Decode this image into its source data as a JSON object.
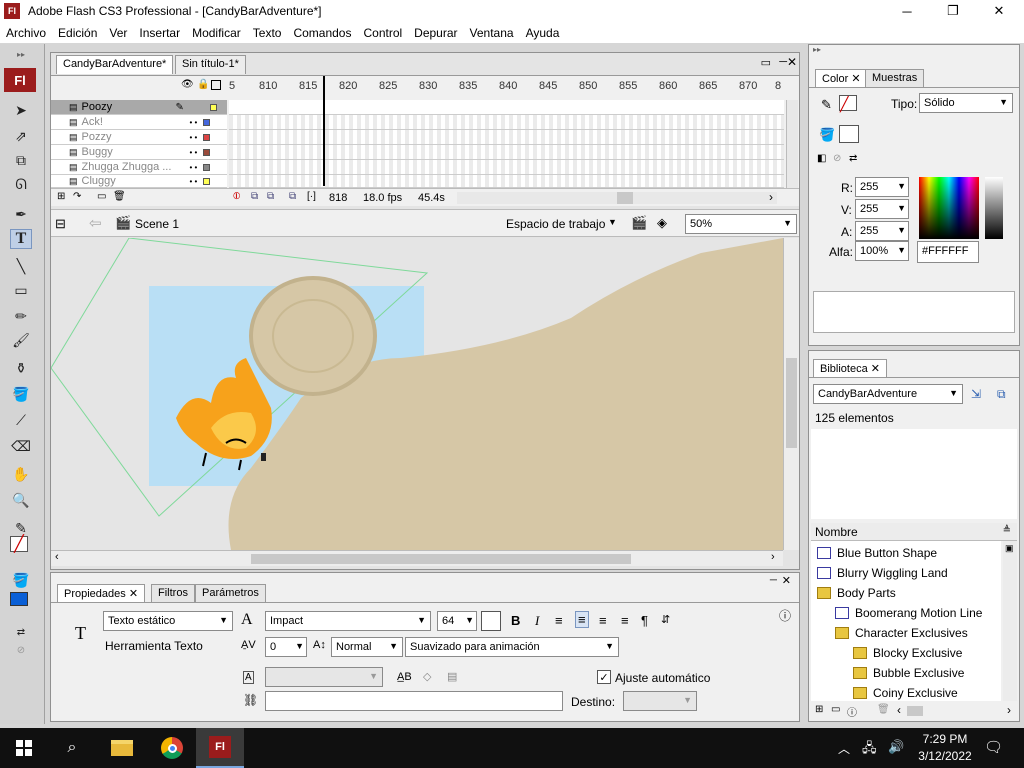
{
  "window": {
    "title": "Adobe Flash CS3 Professional - [CandyBarAdventure*]",
    "app_icon": "Fl"
  },
  "menu": [
    "Archivo",
    "Edición",
    "Ver",
    "Insertar",
    "Modificar",
    "Texto",
    "Comandos",
    "Control",
    "Depurar",
    "Ventana",
    "Ayuda"
  ],
  "tabs": {
    "doc1": "CandyBarAdventure*",
    "doc2": "Sin título-1*"
  },
  "timeline": {
    "ruler": [
      "5",
      "810",
      "815",
      "820",
      "825",
      "830",
      "835",
      "840",
      "845",
      "850",
      "855",
      "860",
      "865",
      "870",
      "8"
    ],
    "layers": [
      "Poozy",
      "Ack!",
      "Pozzy",
      "Buggy",
      "Zhugga Zhugga ...",
      "Cluggy"
    ],
    "frame": "818",
    "fps": "18.0 fps",
    "time": "45.4s"
  },
  "editbar": {
    "scene": "Scene 1",
    "workspace": "Espacio de trabajo",
    "zoom": "50%"
  },
  "color_panel": {
    "tab_color": "Color",
    "tab_swatches": "Muestras",
    "tipo_label": "Tipo:",
    "tipo_value": "Sólido",
    "r_label": "R:",
    "r_value": "255",
    "v_label": "V:",
    "v_value": "255",
    "a_label": "A:",
    "a_value": "255",
    "alpha_label": "Alfa:",
    "alpha_value": "100%",
    "hex": "#FFFFFF"
  },
  "library": {
    "tab": "Biblioteca",
    "doc": "CandyBarAdventure",
    "count": "125 elementos",
    "col_name": "Nombre",
    "items": [
      {
        "label": "Blue Button Shape",
        "kind": "symbol",
        "indent": 0
      },
      {
        "label": "Blurry Wiggling Land",
        "kind": "symbol",
        "indent": 0
      },
      {
        "label": "Body Parts",
        "kind": "folder",
        "indent": 0
      },
      {
        "label": "Boomerang Motion Line",
        "kind": "symbol",
        "indent": 1
      },
      {
        "label": "Character Exclusives",
        "kind": "folder",
        "indent": 1
      },
      {
        "label": "Blocky Exclusive",
        "kind": "folder",
        "indent": 2
      },
      {
        "label": "Bubble Exclusive",
        "kind": "folder",
        "indent": 2
      },
      {
        "label": "Coiny Exclusive",
        "kind": "folder",
        "indent": 2
      }
    ]
  },
  "properties": {
    "tab_props": "Propiedades",
    "tab_filters": "Filtros",
    "tab_params": "Parámetros",
    "text_type": "Texto estático",
    "tool_name": "Herramienta Texto",
    "font": "Impact",
    "size": "64",
    "spacing": "0",
    "position": "Normal",
    "antialias": "Suavizado para animación",
    "autokern": "Ajuste automático",
    "destino": "Destino:"
  },
  "taskbar": {
    "time": "7:29 PM",
    "date": "3/12/2022"
  },
  "colors": {
    "stage_bg": "#e5e5e5",
    "sky": "#b9dff5",
    "sand": "#d6c7a6",
    "flame": "#f7a21b",
    "accent": "#9b1c1c"
  }
}
